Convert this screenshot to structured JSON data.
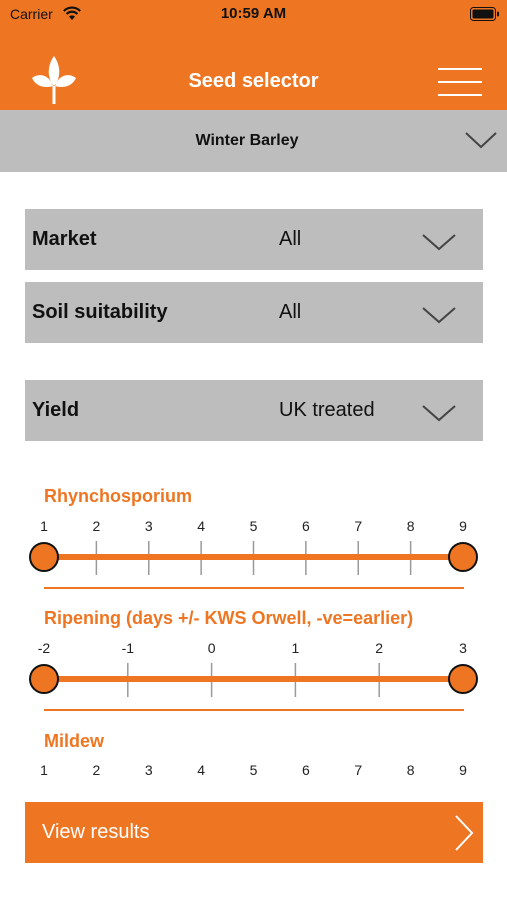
{
  "status_bar": {
    "carrier": "Carrier",
    "time": "10:59 AM"
  },
  "header": {
    "title": "Seed selector",
    "logo_icon": "seedling-logo-icon",
    "menu_icon": "hamburger-menu-icon"
  },
  "crop": {
    "selected": "Winter Barley"
  },
  "filters": {
    "market": {
      "label": "Market",
      "value": "All"
    },
    "soil": {
      "label": "Soil suitability",
      "value": "All"
    },
    "yield": {
      "label": "Yield",
      "value": "UK treated"
    }
  },
  "sliders": {
    "rhynchosporium": {
      "title": "Rhynchosporium",
      "ticks": [
        "1",
        "2",
        "3",
        "4",
        "5",
        "6",
        "7",
        "8",
        "9"
      ],
      "min": 1,
      "max": 9,
      "low": 1,
      "high": 9
    },
    "ripening": {
      "title": "Ripening (days +/- KWS Orwell, -ve=earlier)",
      "ticks": [
        "-2",
        "-1",
        "0",
        "1",
        "2",
        "3"
      ],
      "min": -2,
      "max": 3,
      "low": -2,
      "high": 3
    },
    "mildew": {
      "title": "Mildew",
      "ticks": [
        "1",
        "2",
        "3",
        "4",
        "5",
        "6",
        "7",
        "8",
        "9"
      ]
    }
  },
  "actions": {
    "view_results": "View results"
  },
  "colors": {
    "accent": "#ee7623",
    "panel": "#bdbdbd",
    "tick": "#9a9a9a"
  }
}
